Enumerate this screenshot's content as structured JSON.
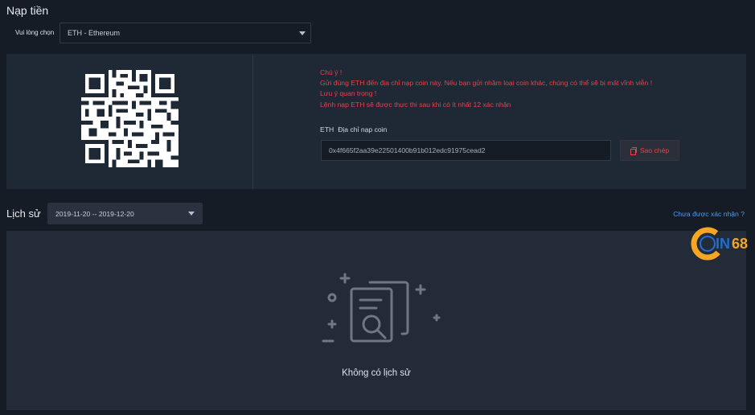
{
  "page": {
    "title": "Nạp tiền"
  },
  "coin_select": {
    "label": "Vui lòng chọn",
    "value": "ETH - Ethereum"
  },
  "deposit": {
    "warnings": [
      "Chú ý !",
      "Gửi đúng ETH đến địa chỉ nạp coin này. Nếu bạn gửi nhầm loại coin khác, chúng có thể sẽ bị mất vĩnh viễn !",
      "Lưu ý quan trọng !",
      "Lệnh nạp ETH sẽ được thực thi sau khi có ít nhất 12 xác nhận"
    ],
    "address_coin": "ETH",
    "address_label": "Địa chỉ nạp coin",
    "address": "0x4f665f2aa39e22501400b91b012edc91975cead2",
    "copy_label": "Sao chép"
  },
  "history": {
    "title": "Lịch sử",
    "date_range": "2019-11-20 -- 2019-12-20",
    "unconfirmed_link": "Chưa được xác nhận ?",
    "empty_text": "Không có lịch sử"
  },
  "watermark": {
    "text_left": "C",
    "text_mid": "IN",
    "text_num": "68"
  },
  "colors": {
    "background": "#161c25",
    "panel": "#1e2935",
    "warning": "#e9414d",
    "link": "#4a9eef",
    "watermark_orange": "#f5a623",
    "watermark_blue": "#1f6fd1"
  }
}
